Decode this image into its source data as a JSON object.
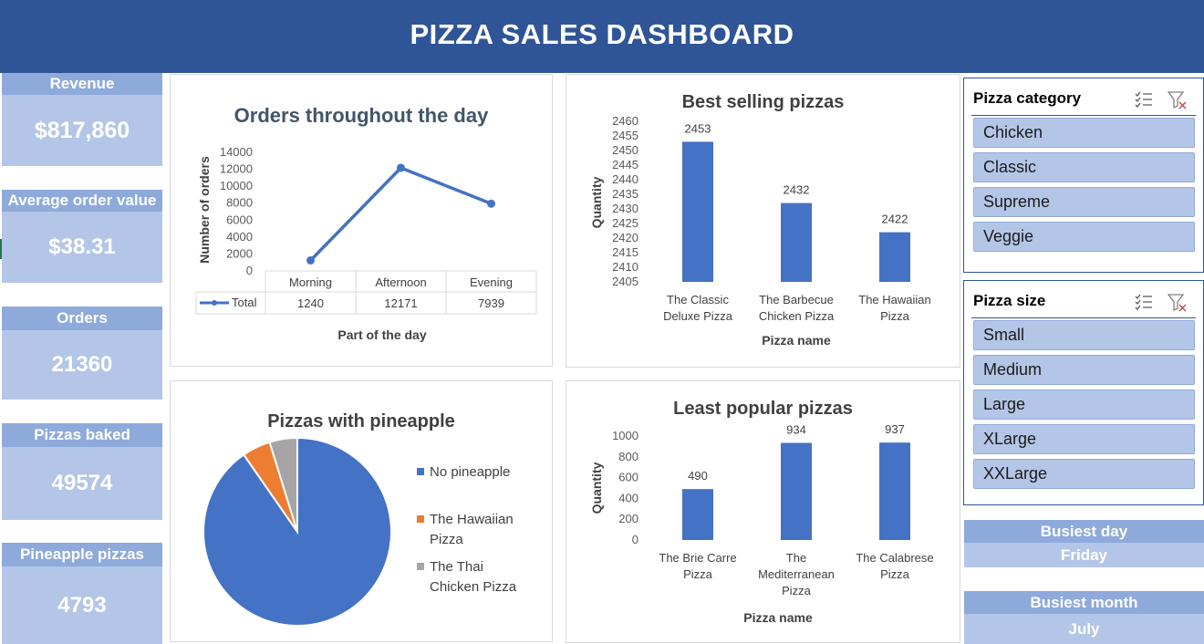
{
  "header": {
    "title": "PIZZA SALES DASHBOARD"
  },
  "kpis": [
    {
      "label": "Revenue",
      "value": "$817,860"
    },
    {
      "label": "Average order value",
      "value": "$38.31"
    },
    {
      "label": "Orders",
      "value": "21360"
    },
    {
      "label": "Pizzas baked",
      "value": "49574"
    },
    {
      "label": "Pineapple pizzas",
      "value": "4793"
    }
  ],
  "colors": {
    "header": "#2f5597",
    "kpi_label": "#8eaadb",
    "kpi_box": "#b4c6e7",
    "series_blue": "#4472c4",
    "series_orange": "#ed7d31",
    "series_gray": "#a5a5a5"
  },
  "slicers": [
    {
      "title": "Pizza category",
      "items": [
        "Chicken",
        "Classic",
        "Supreme",
        "Veggie"
      ],
      "icons": [
        "multi-select-icon",
        "clear-filter-icon"
      ]
    },
    {
      "title": "Pizza size",
      "items": [
        "Small",
        "Medium",
        "Large",
        "XLarge",
        "XXLarge"
      ],
      "icons": [
        "multi-select-icon",
        "clear-filter-icon"
      ]
    }
  ],
  "busiest": [
    {
      "label": "Busiest day",
      "value": "Friday"
    },
    {
      "label": "Busiest month",
      "value": "July"
    }
  ],
  "chart_data": [
    {
      "type": "line",
      "title": "Orders throughout the day",
      "xlabel": "Part of the day",
      "ylabel": "Number of orders",
      "categories": [
        "Morning",
        "Afternoon",
        "Evening"
      ],
      "series": [
        {
          "name": "Total",
          "values": [
            1240,
            12171,
            7939
          ]
        }
      ],
      "ylim": [
        0,
        14000
      ],
      "yticks": [
        "14000",
        "12000",
        "10000",
        "8000",
        "6000",
        "4000",
        "2000",
        "0"
      ],
      "data_table": true
    },
    {
      "type": "bar",
      "title": "Best selling pizzas",
      "xlabel": "Pizza name",
      "ylabel": "Quantity",
      "categories": [
        [
          "The Classic",
          "Deluxe Pizza"
        ],
        [
          "The Barbecue",
          "Chicken Pizza"
        ],
        [
          "The Hawaiian",
          "Pizza"
        ]
      ],
      "values": [
        2453,
        2432,
        2422
      ],
      "ylim": [
        2405,
        2460
      ],
      "yticks": [
        "2460",
        "2455",
        "2450",
        "2445",
        "2440",
        "2435",
        "2430",
        "2425",
        "2420",
        "2415",
        "2410",
        "2405"
      ]
    },
    {
      "type": "pie",
      "title": "Pizzas with pineapple",
      "labels": [
        "No pineapple",
        "The Hawaiian Pizza",
        "The Thai Chicken Pizza"
      ],
      "legend_lines": [
        [
          "No pineapple"
        ],
        [
          "The Hawaiian",
          "Pizza"
        ],
        [
          "The Thai",
          "Chicken Pizza"
        ]
      ],
      "values": [
        44781,
        2422,
        2371
      ],
      "legend": "right"
    },
    {
      "type": "bar",
      "title": "Least popular pizzas",
      "xlabel": "Pizza name",
      "ylabel": "Quantity",
      "categories": [
        [
          "The Brie Carre",
          "Pizza"
        ],
        [
          "The",
          "Mediterranean",
          "Pizza"
        ],
        [
          "The Calabrese",
          "Pizza"
        ]
      ],
      "values": [
        490,
        934,
        937
      ],
      "ylim": [
        0,
        1000
      ],
      "yticks": [
        "1000",
        "800",
        "600",
        "400",
        "200",
        "0"
      ]
    }
  ]
}
